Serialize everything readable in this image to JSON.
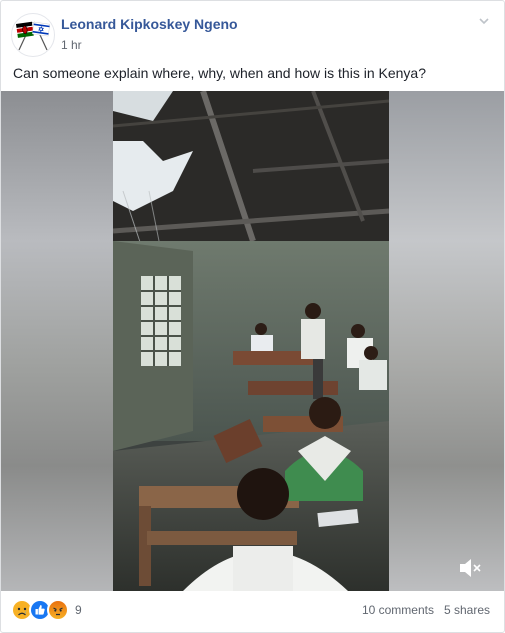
{
  "post": {
    "author": "Leonard Kipkoskey Ngeno",
    "time": "1 hr",
    "text": "Can someone explain where, why, when and how is this in Kenya?"
  },
  "icons": {
    "avatar": "kenya-israel-flags-icon",
    "menu": "chevron-down-icon",
    "volume": "muted-speaker-icon"
  },
  "reactions": {
    "types": [
      "sad",
      "like",
      "angry"
    ],
    "count": "9"
  },
  "stats": {
    "comments": "10 comments",
    "shares": "5 shares"
  },
  "colors": {
    "author_link": "#365899",
    "secondary_text": "#616770",
    "like_blue": "#1877f2",
    "reaction_yellow": "#f7b125",
    "angry_orange": "#e9710f"
  }
}
